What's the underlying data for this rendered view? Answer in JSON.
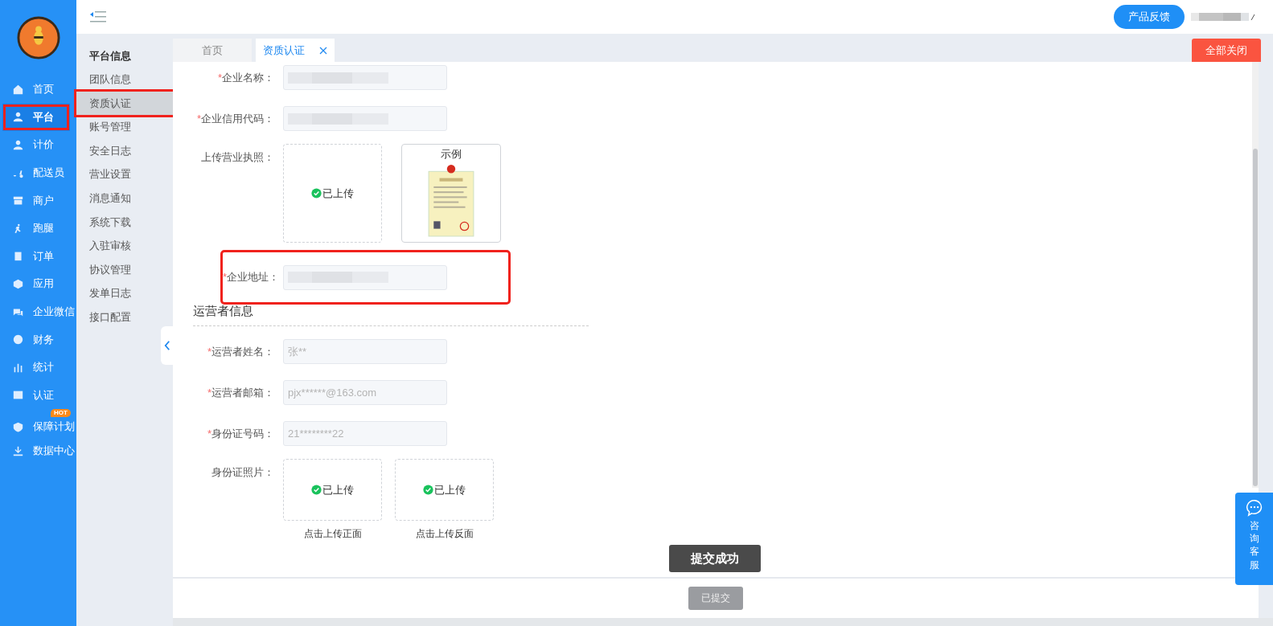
{
  "sidebar": {
    "items": [
      {
        "label": "首页",
        "selected": false,
        "highlighted": false
      },
      {
        "label": "平台",
        "selected": true,
        "highlighted": true
      },
      {
        "label": "计价",
        "selected": false,
        "highlighted": false
      },
      {
        "label": "配送员",
        "selected": false,
        "highlighted": false
      },
      {
        "label": "商户",
        "selected": false,
        "highlighted": false
      },
      {
        "label": "跑腿",
        "selected": false,
        "highlighted": false
      },
      {
        "label": "订单",
        "selected": false,
        "highlighted": false
      },
      {
        "label": "应用",
        "selected": false,
        "highlighted": false
      },
      {
        "label": "企业微信",
        "selected": false,
        "highlighted": false
      },
      {
        "label": "财务",
        "selected": false,
        "highlighted": false
      },
      {
        "label": "统计",
        "selected": false,
        "highlighted": false
      },
      {
        "label": "认证",
        "selected": false,
        "highlighted": false
      },
      {
        "label": "保障计划",
        "selected": false,
        "highlighted": false,
        "badge": "HOT"
      },
      {
        "label": "数据中心",
        "selected": false,
        "highlighted": false
      }
    ]
  },
  "submenu": {
    "title": "平台信息",
    "items": [
      {
        "label": "团队信息",
        "selected": false,
        "highlighted": false
      },
      {
        "label": "资质认证",
        "selected": true,
        "highlighted": true
      },
      {
        "label": "账号管理",
        "selected": false,
        "highlighted": false
      },
      {
        "label": "安全日志",
        "selected": false,
        "highlighted": false
      },
      {
        "label": "营业设置",
        "selected": false,
        "highlighted": false
      },
      {
        "label": "消息通知",
        "selected": false,
        "highlighted": false
      },
      {
        "label": "系统下载",
        "selected": false,
        "highlighted": false
      },
      {
        "label": "入驻审核",
        "selected": false,
        "highlighted": false
      },
      {
        "label": "协议管理",
        "selected": false,
        "highlighted": false
      },
      {
        "label": "发单日志",
        "selected": false,
        "highlighted": false
      },
      {
        "label": "接口配置",
        "selected": false,
        "highlighted": false
      }
    ]
  },
  "header": {
    "feedback_button": "产品反馈"
  },
  "tabs": [
    {
      "label": "首页",
      "selected": false,
      "closable": false
    },
    {
      "label": "资质认证",
      "selected": true,
      "closable": true
    }
  ],
  "close_all_button": "全部关闭",
  "sections": [
    {
      "fields": [
        {
          "kind": "input",
          "label": "企业名称：",
          "required_mark": "*",
          "highlighted": false
        },
        {
          "kind": "input",
          "label": "企业信用代码：",
          "required_mark": "*",
          "highlighted": false
        },
        {
          "kind": "upload",
          "label": "上传营业执照：",
          "highlighted": false,
          "slots": [
            {
              "status": "已上传"
            }
          ],
          "example": {
            "title": "示例"
          }
        },
        {
          "kind": "input",
          "label": "企业地址：",
          "required_mark": "*",
          "highlighted": true
        }
      ]
    },
    {
      "title": "运营者信息",
      "fields": [
        {
          "kind": "input",
          "label": "运营者姓名：",
          "required_mark": "*",
          "highlighted": false,
          "value": "张**"
        },
        {
          "kind": "input",
          "label": "运营者邮箱：",
          "required_mark": "*",
          "highlighted": false,
          "value": "pjx******@163.com"
        },
        {
          "kind": "input",
          "label": "身份证号码：",
          "required_mark": "*",
          "highlighted": false,
          "value": "21********22"
        },
        {
          "kind": "upload",
          "label": "身份证照片：",
          "highlighted": false,
          "slots": [
            {
              "status": "已上传",
              "caption": "点击上传正面"
            },
            {
              "status": "已上传",
              "caption": "点击上传反面"
            }
          ]
        }
      ]
    }
  ],
  "toast": "提交成功",
  "submit_button": {
    "label": "已提交",
    "disabled": true
  },
  "consult_button": "咨询客服"
}
